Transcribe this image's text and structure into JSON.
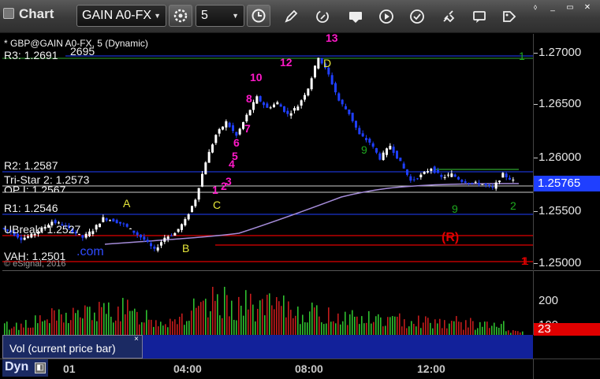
{
  "toolbar": {
    "title": "Chart",
    "symbol": "GAIN A0-FX",
    "interval": "5",
    "icons": [
      "settings-icon",
      "clock-icon",
      "pencil-icon",
      "refresh-icon",
      "get-icon",
      "play-icon",
      "alert-icon",
      "link-icon",
      "comment-icon",
      "tag-icon"
    ]
  },
  "chart": {
    "header": "* GBP@GAIN A0-FX, 5 (Dynamic)",
    "levels": {
      "r3": "R3: 1.2691",
      "r3_extra": "2695",
      "r2": "R2: 1.2587",
      "tristar": "Tri-Star 2: 1.2573",
      "op": "OP I: 1.2567",
      "r1": "R1: 1.2546",
      "ubreak": "UBreak: 1.2527",
      "vah": "VAH: 1.2501"
    },
    "watermark_site": ".com",
    "copyright": "© eSignal, 2016",
    "annotations": {
      "A": "A",
      "B": "B",
      "C": "C",
      "D": "D",
      "R": "(R)",
      "count_magenta": [
        "1",
        "2",
        "3",
        "4",
        "5",
        "6",
        "7",
        "8",
        "10",
        "12",
        "13"
      ],
      "count_green": [
        "9",
        "9",
        "2",
        "1",
        "1"
      ]
    }
  },
  "price_axis": {
    "ticks": [
      "1.27000",
      "1.26500",
      "1.26000",
      "1.25500",
      "1.25000"
    ],
    "current_price": "1.25765",
    "current_marker": "1"
  },
  "volume": {
    "legend": "Vol (current price bar)",
    "close": "×",
    "axis_ticks": [
      "200",
      "100"
    ],
    "current": "23"
  },
  "time_axis": {
    "dyn_label": "Dyn",
    "dyn_icon": "◧",
    "labels": [
      "01",
      "04:00",
      "08:00",
      "12:00"
    ]
  },
  "colors": {
    "bull": "#ffffff",
    "bear": "#1f3fff",
    "green_line": "#2fa52f",
    "red_line": "#e00000",
    "purple_line": "#a48bd8",
    "magenta": "#ff19c8",
    "count_green": "#1fa91f",
    "yellow": "#e7e73a"
  },
  "chart_data": {
    "type": "candlestick",
    "title": "* GBP@GAIN A0-FX, 5 (Dynamic)",
    "x": [
      "01",
      "04:00",
      "08:00",
      "12:00"
    ],
    "ylim": [
      1.25,
      1.271
    ],
    "yticks": [
      1.27,
      1.265,
      1.26,
      1.255,
      1.25
    ],
    "path": [
      [
        0,
        1.2533
      ],
      [
        6,
        1.2529
      ],
      [
        12,
        1.2523
      ],
      [
        18,
        1.2526
      ],
      [
        24,
        1.2532
      ],
      [
        30,
        1.2539
      ],
      [
        36,
        1.2536
      ],
      [
        42,
        1.253
      ],
      [
        48,
        1.2524
      ],
      [
        54,
        1.2531
      ],
      [
        60,
        1.2542
      ],
      [
        66,
        1.254
      ],
      [
        72,
        1.2536
      ],
      [
        78,
        1.2529
      ],
      [
        84,
        1.2522
      ],
      [
        90,
        1.2512
      ],
      [
        96,
        1.2524
      ],
      [
        102,
        1.2528
      ],
      [
        108,
        1.254
      ],
      [
        114,
        1.256
      ],
      [
        120,
        1.2595
      ],
      [
        126,
        1.262
      ],
      [
        132,
        1.2632
      ],
      [
        138,
        1.2619
      ],
      [
        144,
        1.2638
      ],
      [
        150,
        1.2655
      ],
      [
        156,
        1.2645
      ],
      [
        162,
        1.265
      ],
      [
        168,
        1.2639
      ],
      [
        174,
        1.2647
      ],
      [
        180,
        1.2664
      ],
      [
        186,
        1.2693
      ],
      [
        192,
        1.2676
      ],
      [
        198,
        1.2652
      ],
      [
        204,
        1.264
      ],
      [
        210,
        1.262
      ],
      [
        216,
        1.2613
      ],
      [
        222,
        1.2598
      ],
      [
        228,
        1.261
      ],
      [
        234,
        1.2594
      ],
      [
        240,
        1.2577
      ],
      [
        246,
        1.2582
      ],
      [
        252,
        1.2589
      ],
      [
        258,
        1.258
      ],
      [
        264,
        1.2583
      ],
      [
        270,
        1.2577
      ],
      [
        276,
        1.2575
      ],
      [
        282,
        1.2574
      ],
      [
        288,
        1.257
      ],
      [
        294,
        1.2583
      ],
      [
        300,
        1.2577
      ]
    ],
    "volume": [
      60,
      85,
      110,
      130,
      140,
      150,
      120,
      90,
      110,
      150,
      200,
      180,
      170,
      160,
      140,
      120,
      115,
      100,
      90,
      95,
      85,
      80,
      70,
      60,
      23
    ]
  }
}
